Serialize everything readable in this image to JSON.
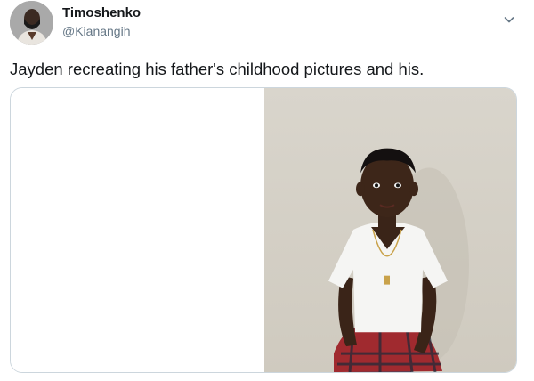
{
  "tweet": {
    "display_name": "Timoshenko",
    "handle": "@Kianangih",
    "text": "Jayden recreating his father's childhood pictures and his."
  },
  "icons": {
    "avatar": "user-avatar-photo",
    "menu": "chevron-down-icon"
  },
  "media": {
    "left_photo": "blank-photo",
    "right_photo": "child-photo"
  },
  "colors": {
    "text_primary": "#14171a",
    "text_secondary": "#657786",
    "border": "#ccd6dd"
  }
}
